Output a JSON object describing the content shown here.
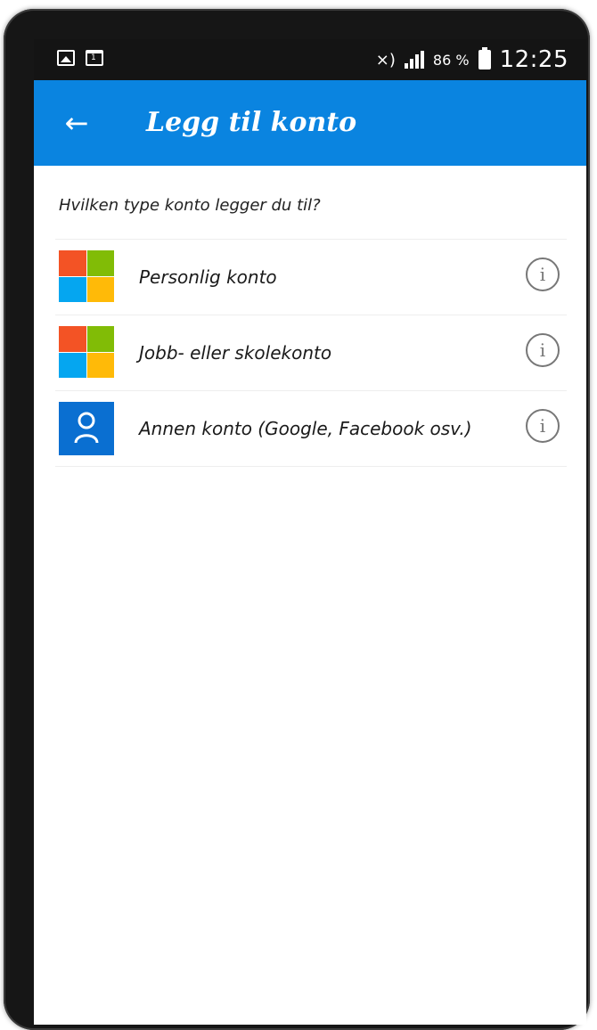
{
  "status_bar": {
    "left_icons": [
      "image-icon",
      "calendar-icon"
    ],
    "calendar_day": "1",
    "mute_icon": "mute-icon",
    "signal_icon": "signal-icon",
    "battery_percent": "86 %",
    "battery_icon": "battery-icon",
    "time": "12:25"
  },
  "app_bar": {
    "back_icon": "←",
    "title": "Legg til konto",
    "color": "#0a84e0"
  },
  "content": {
    "question": "Hvilken type konto legger du til?",
    "accounts": [
      {
        "icon": "microsoft-logo-icon",
        "label": "Personlig konto",
        "info_icon": "i"
      },
      {
        "icon": "microsoft-logo-icon",
        "label": "Jobb- eller skolekonto",
        "info_icon": "i"
      },
      {
        "icon": "person-icon",
        "label": "Annen konto (Google, Facebook osv.)",
        "info_icon": "i"
      }
    ]
  },
  "colors": {
    "ms_red": "#f35325",
    "ms_green": "#81bc06",
    "ms_blue": "#05a6f0",
    "ms_yellow": "#ffba08",
    "person_tile": "#0a6fd1",
    "status_bar": "#141414"
  }
}
